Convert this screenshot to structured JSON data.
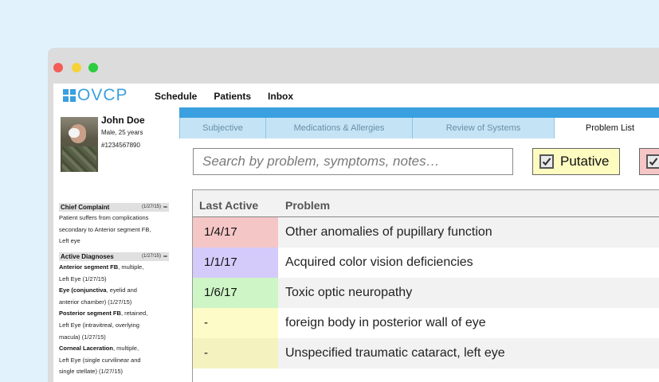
{
  "app": {
    "logo_text": "OVCP",
    "nav": [
      "Schedule",
      "Patients",
      "Inbox"
    ]
  },
  "patient": {
    "name": "John Doe",
    "info": "Male, 25 years",
    "id": "#1234567890"
  },
  "chief_complaint": {
    "title": "Chief Complaint",
    "date": "(1/27/15)",
    "collapse": "−",
    "text_lines": [
      "Patient suffers from complications",
      "secondary to Anterior segment FB,",
      "Left eye"
    ]
  },
  "active_diagnoses": {
    "title": "Active Diagnoses",
    "date": "(1/27/15)",
    "collapse": "−",
    "items": [
      {
        "bold": "Anterior segment FB",
        "rest": ", multiple,",
        "line2": "Left Eye (1/27/15)"
      },
      {
        "bold": "Eye (conjunctiva",
        "rest": ", eyelid and",
        "line2": "anterior chamber) (1/27/15)"
      },
      {
        "bold": "Posterior segment FB",
        "rest": ", retained,",
        "line2": "Left Eye (intravitreal, overlying",
        "line3": "macula) (1/27/15)"
      },
      {
        "bold": "Corneal Laceration",
        "rest": ", multiple,",
        "line2": "Left Eye (single curvilinear and",
        "line3": "single stellate) (1/27/15)"
      }
    ]
  },
  "tabs": [
    "Subjective",
    "Medications & Allergies",
    "Review of Systems",
    "Problem List"
  ],
  "active_tab": "Problem List",
  "search": {
    "placeholder": "Search by problem, symptoms, notes…"
  },
  "filters": [
    {
      "label": "Putative",
      "checked": true,
      "color": "#fdfbc0"
    },
    {
      "label": "",
      "checked": true,
      "color": "#f6c6c6"
    }
  ],
  "table": {
    "headers": [
      "Last Active",
      "Problem"
    ],
    "rows": [
      {
        "date": "1/4/17",
        "problem": "Other anomalies of pupillary function",
        "color": "#f5c6c6"
      },
      {
        "date": "1/1/17",
        "problem": "Acquired color vision deficiencies",
        "color": "#d5cbfa"
      },
      {
        "date": "1/6/17",
        "problem": "Toxic optic neuropathy",
        "color": "#cdf5c5"
      },
      {
        "date": "-",
        "problem": "foreign body in posterior wall of eye",
        "color": "#fdfbc7"
      },
      {
        "date": "-",
        "problem": "Unspecified traumatic cataract, left eye",
        "color": "#f4f3c0"
      }
    ]
  }
}
